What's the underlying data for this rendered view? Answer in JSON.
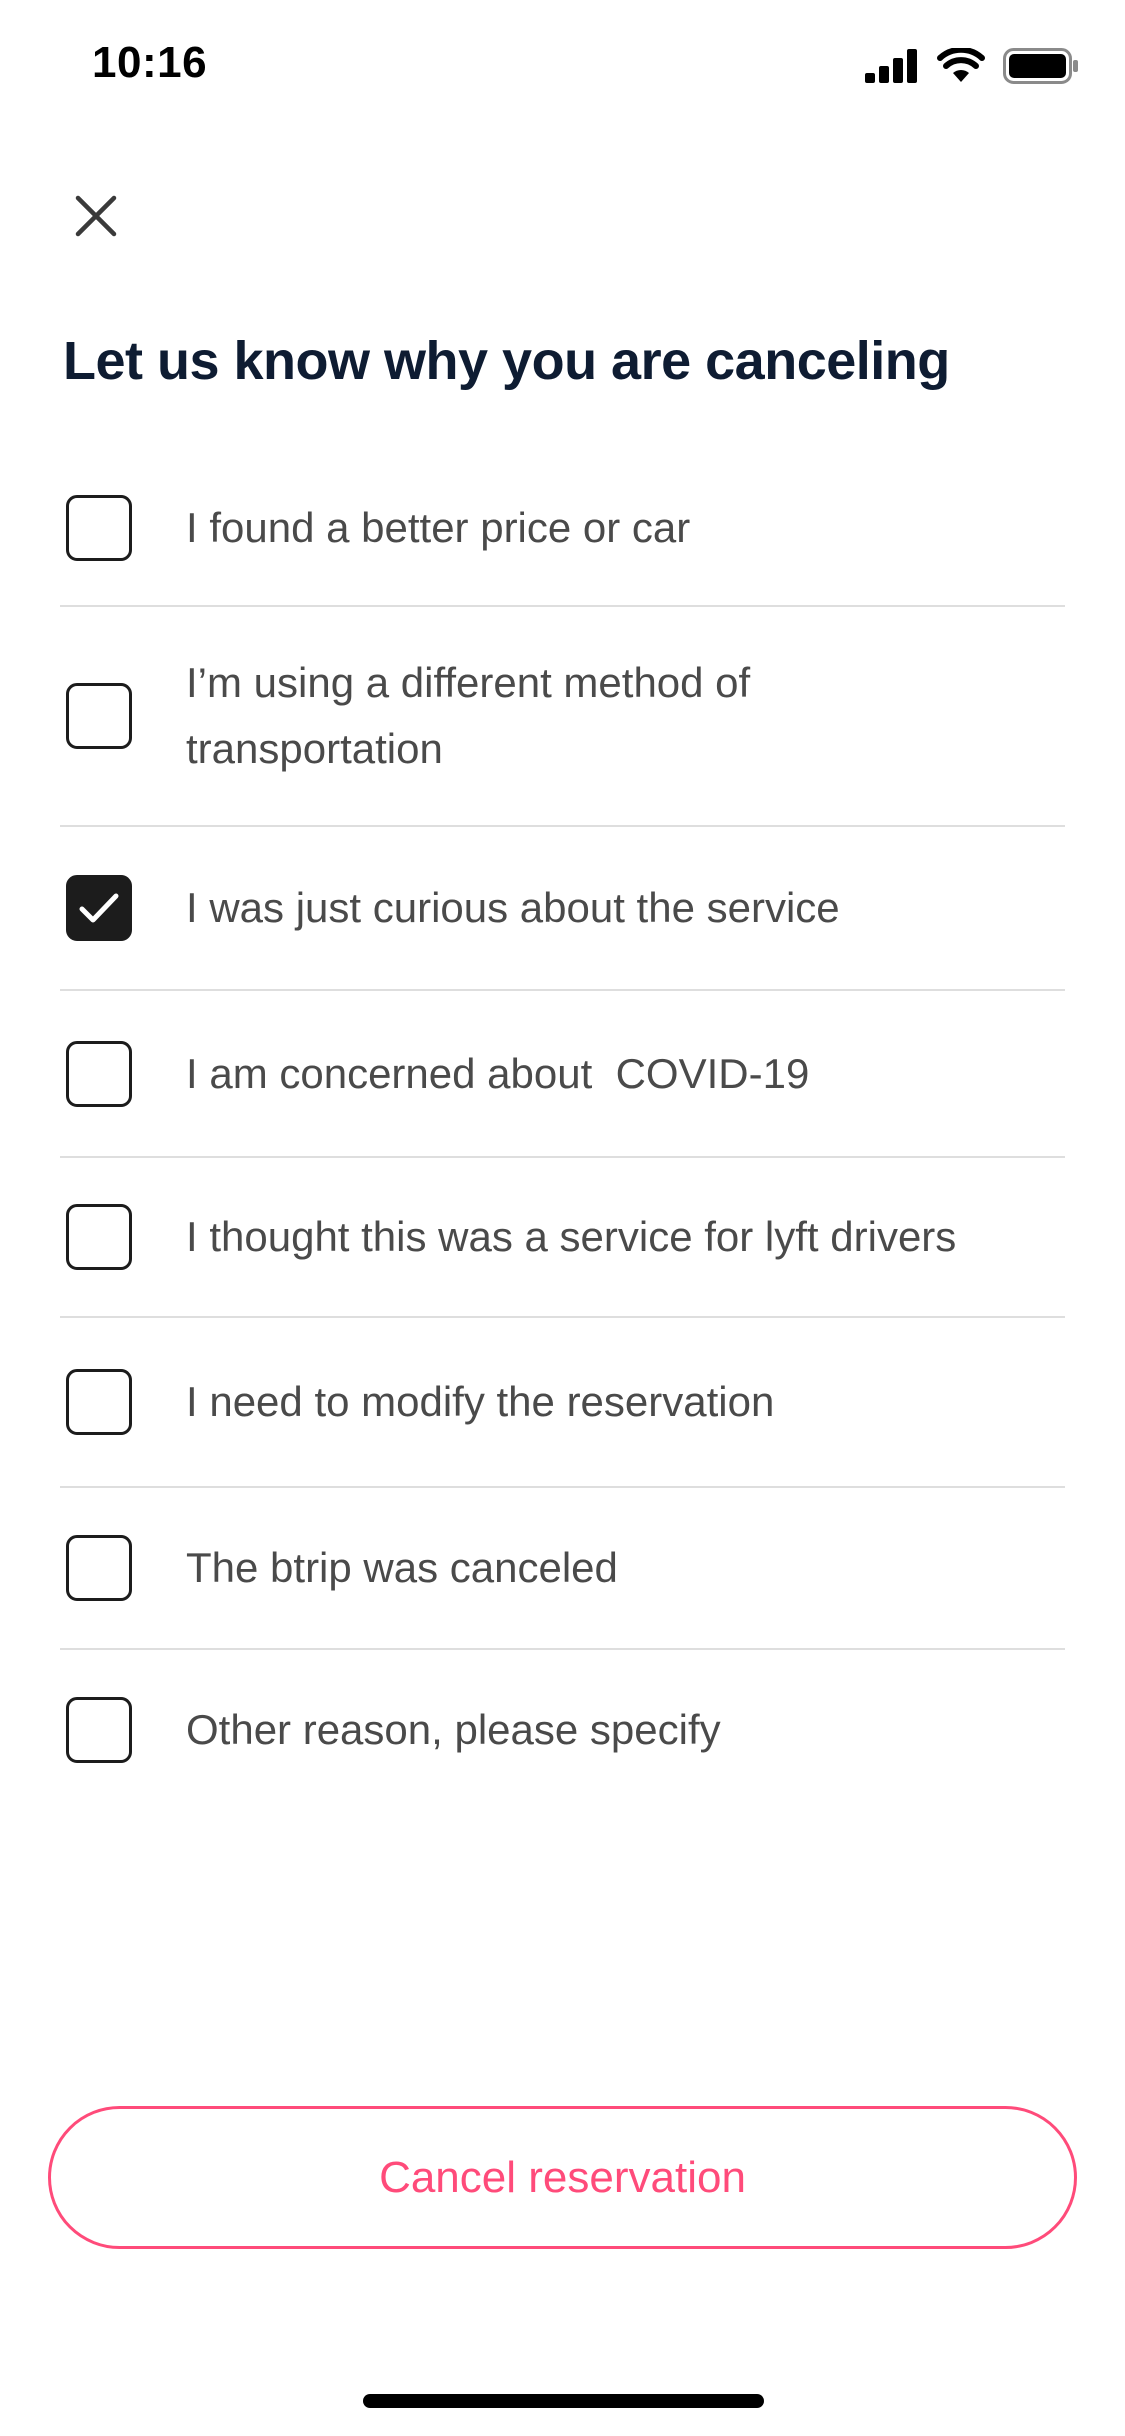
{
  "status_bar": {
    "time": "10:16",
    "signal_icon": "cellular-signal-icon",
    "wifi_icon": "wifi-icon",
    "battery_icon": "battery-icon"
  },
  "header": {
    "close_icon": "close-icon"
  },
  "title": "Let us know why you are canceling",
  "reasons": [
    {
      "label": "I found a better price or car",
      "checked": false
    },
    {
      "label": "I’m using a different method of\ntransportation",
      "checked": false
    },
    {
      "label": "I was just curious about the service",
      "checked": true
    },
    {
      "label": "I am concerned about  COVID-19",
      "checked": false
    },
    {
      "label": "I thought this was a service for lyft drivers",
      "checked": false
    },
    {
      "label": "I need to modify the reservation",
      "checked": false
    },
    {
      "label": "The btrip was canceled",
      "checked": false
    },
    {
      "label": "Other reason, please specify",
      "checked": false
    }
  ],
  "cancel_button": {
    "label": "Cancel reservation"
  },
  "colors": {
    "accent": "#ff4b7a",
    "title": "#0e1c32",
    "text": "#4a4a4a",
    "checkbox": "#1c1c1c",
    "divider": "#dedede"
  }
}
